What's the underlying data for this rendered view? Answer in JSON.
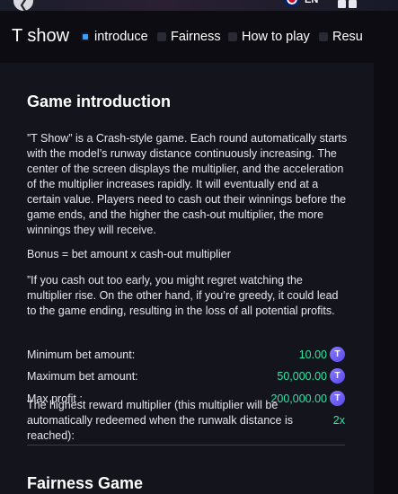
{
  "topbar": {
    "language": "EN",
    "back_icon": "back-icon",
    "menu_icon": "grid-icon"
  },
  "header": {
    "title": "T show",
    "tabs": [
      {
        "label": "introduce",
        "active": true
      },
      {
        "label": "Fairness",
        "active": false
      },
      {
        "label": "How to play",
        "active": false
      },
      {
        "label": "Resu",
        "active": false
      }
    ]
  },
  "intro": {
    "title": "Game introduction",
    "paragraph1": "”T Show” is a Crash-style game. Each round automatically starts with the model’s runway distance continuously increasing. The center of the screen displays the multiplier, and the acceleration of the multiplier increases rapidly. It will eventually end at a certain value. Players need to cash out their winnings before the game ends, and the higher the cash-out multiplier, the more winnings they will receive.",
    "bonus": "Bonus = bet amount x cash-out multiplier",
    "paragraph2": "”If you cash out too early, you might regret watching the multiplier rise. On the other hand, if you’re greedy, it could lead to the game ending, resulting in the loss of all potential profits."
  },
  "limits": {
    "min_label": "Minimum bet amount:",
    "min_value": "10.00",
    "max_label": "Maximum bet amount:",
    "max_value": "50,000.00",
    "profit_label": "Max profit :",
    "profit_value": "200,000.00",
    "reward_label": "The highest reward multiplier (this multiplier will be automatically redeemed when the runwalk distance is reached):",
    "reward_value": "2x",
    "coin_icon": "token-coin-icon"
  },
  "fairness": {
    "title": "Fairness Game"
  }
}
